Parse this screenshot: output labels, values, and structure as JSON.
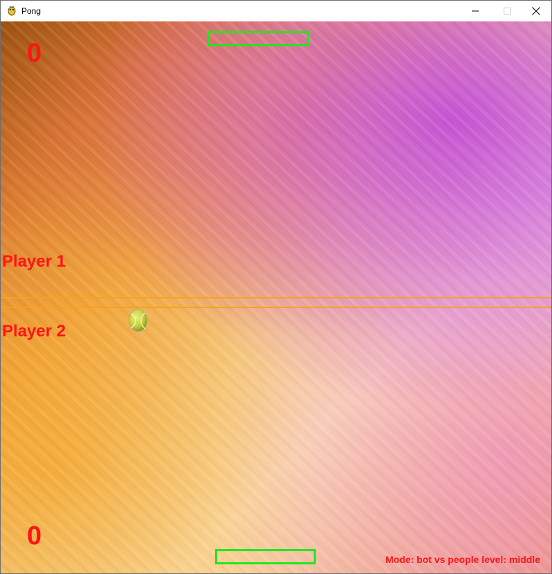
{
  "window": {
    "title": "Pong",
    "app_icon": "pygame-snake-icon",
    "controls": {
      "minimize_icon": "minimize-icon",
      "maximize_icon": "maximize-icon",
      "close_icon": "close-icon"
    }
  },
  "game": {
    "score_top": "0",
    "score_bottom": "0",
    "player1_label": "Player 1",
    "player2_label": "Player 2",
    "mode_text": "Mode: bot vs people level: middle",
    "ball_icon": "tennis-ball-icon",
    "colors": {
      "paddle": "#22e61c",
      "text": "#ff1414",
      "midline": "#f7a21a"
    }
  }
}
